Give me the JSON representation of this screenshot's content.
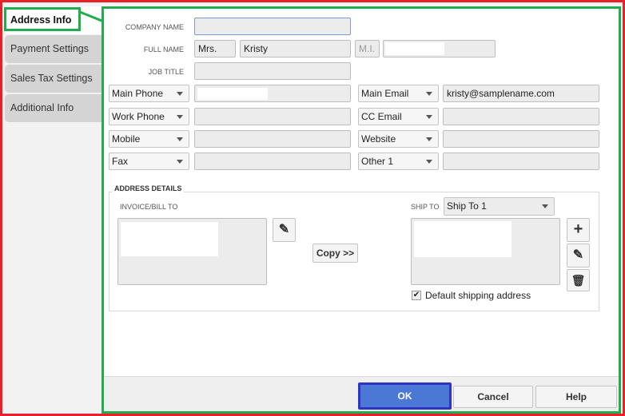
{
  "tabs": [
    {
      "label": "Address Info",
      "active": true
    },
    {
      "label": "Payment Settings"
    },
    {
      "label": "Sales Tax Settings"
    },
    {
      "label": "Additional Info"
    }
  ],
  "form": {
    "company_name_label": "COMPANY NAME",
    "company_name": "",
    "full_name_label": "FULL NAME",
    "title": "Mrs.",
    "first_name": "Kristy",
    "mi_placeholder": "M.I.",
    "last_name": "",
    "job_title_label": "JOB TITLE",
    "job_title": "",
    "contacts_left": [
      {
        "type": "Main Phone",
        "value": ""
      },
      {
        "type": "Work Phone",
        "value": ""
      },
      {
        "type": "Mobile",
        "value": ""
      },
      {
        "type": "Fax",
        "value": ""
      }
    ],
    "contacts_right": [
      {
        "type": "Main Email",
        "value": "kristy@samplename.com"
      },
      {
        "type": "CC Email",
        "value": ""
      },
      {
        "type": "Website",
        "value": ""
      },
      {
        "type": "Other 1",
        "value": ""
      }
    ]
  },
  "address": {
    "legend": "ADDRESS DETAILS",
    "bill_to_label": "INVOICE/BILL TO",
    "copy_label": "Copy >>",
    "ship_to_label": "SHIP TO",
    "ship_to_selected": "Ship To 1",
    "default_shipping_label": "Default shipping address",
    "default_shipping_checked": true
  },
  "footer": {
    "ok": "OK",
    "cancel": "Cancel",
    "help": "Help"
  },
  "colors": {
    "highlight_red": "#e8202a",
    "highlight_green": "#1fae4b",
    "ok_blue": "#3a62c8"
  }
}
